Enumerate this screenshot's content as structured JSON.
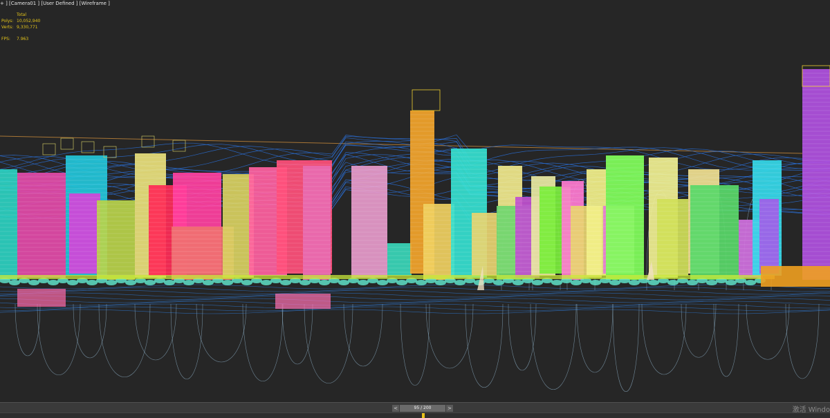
{
  "viewport": {
    "label": "+ ] [Camera01 ] [User Defined ] [Wireframe ]",
    "stats": {
      "header": "Total",
      "polys_label": "Polys:",
      "polys_value": "10,052,940",
      "verts_label": "Verts:",
      "verts_value": "9,330,771",
      "fps_label": "FPS:",
      "fps_value": "7.963"
    }
  },
  "timeline": {
    "prev_icon": "chevron-left-icon",
    "next_icon": "chevron-right-icon",
    "prev_symbol": "<",
    "next_symbol": ">",
    "frame_text": "95 / 200",
    "current_frame_fraction": 0.475
  },
  "watermark": "激活 Windo",
  "colors": {
    "background": "#262626",
    "stats_text": "#e5c51a",
    "timeline_marker": "#e8c21a",
    "terrain_wire": "#2a6fd6",
    "guide_curves": "#8fb1c8"
  }
}
